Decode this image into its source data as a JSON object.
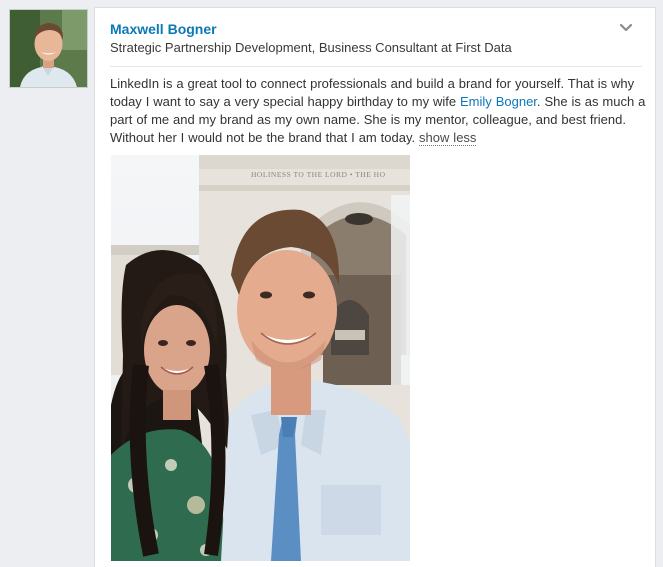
{
  "post": {
    "author_name": "Maxwell Bogner",
    "author_headline": "Strategic Partnership Development, Business Consultant at First Data",
    "text_before_mention": "LinkedIn is a great tool to connect professionals and build a brand for yourself. That is why today I want to say a very special happy birthday to my wife ",
    "mention_name": "Emily Bogner",
    "text_after_mention": ". She is as much a part of me and my brand as my own name. She is my mentor, colleague, and best friend. Without her I would not be the brand that I am today.",
    "show_less_label": "show less",
    "photo_sign_text": "HOLINESS TO THE LORD • THE HO"
  },
  "icons": {
    "options": "chevron-down-icon",
    "avatar": "profile-photo"
  },
  "colors": {
    "link": "#0b78b7",
    "page_bg": "#eceef1"
  }
}
